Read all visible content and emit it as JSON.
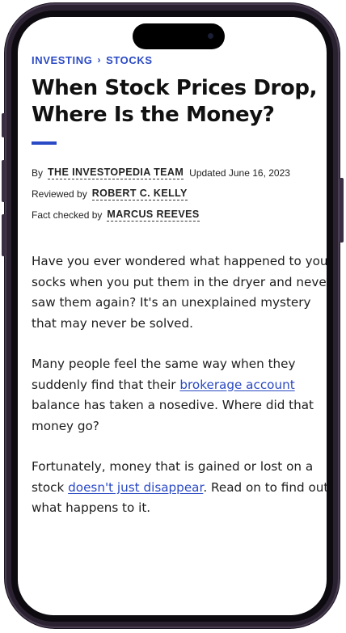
{
  "breadcrumb": {
    "parent": "INVESTING",
    "separator": "›",
    "current": "STOCKS"
  },
  "article": {
    "title_line1": "When Stock Prices Drop,",
    "title_line2": "Where Is the Money?",
    "byline": {
      "by_label": "By",
      "author": "THE INVESTOPEDIA TEAM",
      "updated": "Updated June 16, 2023",
      "reviewed_label": "Reviewed by",
      "reviewer": "ROBERT C. KELLY",
      "fact_label": "Fact checked by",
      "fact_checker": "MARCUS REEVES"
    },
    "paragraphs": {
      "p1": {
        "l1": "Have you ever wondered what happened to your",
        "l2": "socks when you put them in the dryer and never",
        "l3": "saw them again? It's an unexplained mystery",
        "l4": "that may never be solved."
      },
      "p2": {
        "l1": "Many people feel the same way when they",
        "l2_before": "suddenly find that their ",
        "l2_link": "brokerage account",
        "l3": "balance has taken a nosedive. Where did that",
        "l4": "money go?"
      },
      "p3": {
        "l1": "Fortunately, money that is gained or lost on a",
        "l2_before": "stock ",
        "l2_link": "doesn't just disappear",
        "l2_after": ". Read on to find out",
        "l3": "what happens to it."
      }
    }
  },
  "colors": {
    "accent": "#2a49c4",
    "text": "#1d1d1d",
    "frame": "#2b2231"
  }
}
